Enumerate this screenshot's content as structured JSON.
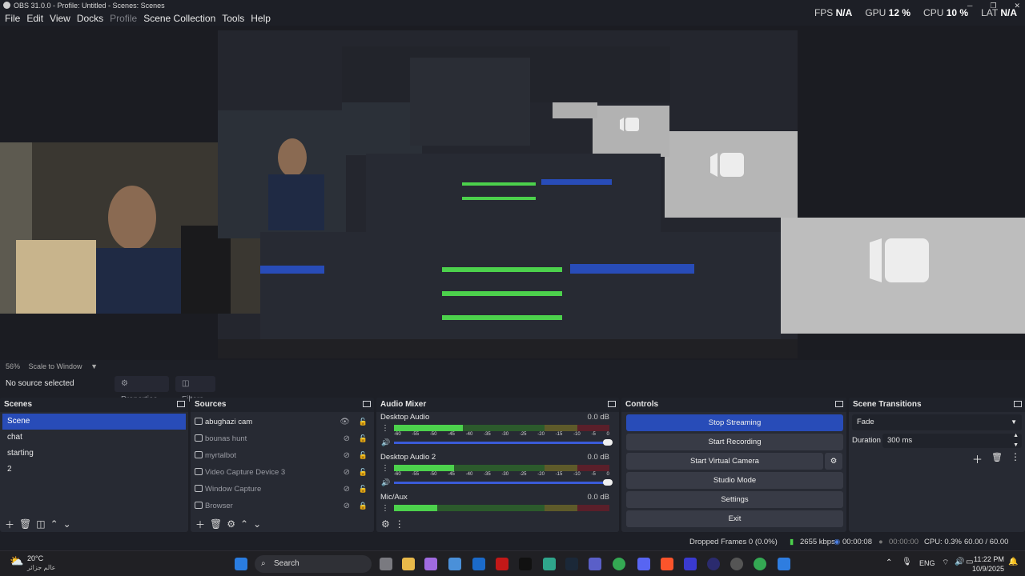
{
  "window": {
    "title": "OBS 31.0.0 - Profile: Untitled - Scenes: Scenes",
    "controls": [
      "─",
      "❐",
      "✕"
    ]
  },
  "menu": [
    {
      "label": "File",
      "disabled": false
    },
    {
      "label": "Edit",
      "disabled": false
    },
    {
      "label": "View",
      "disabled": false
    },
    {
      "label": "Docks",
      "disabled": false
    },
    {
      "label": "Profile",
      "disabled": true
    },
    {
      "label": "Scene Collection",
      "disabled": false
    },
    {
      "label": "Tools",
      "disabled": false
    },
    {
      "label": "Help",
      "disabled": false
    }
  ],
  "stats": {
    "fps_label": "FPS",
    "fps_value": "N/A",
    "gpu_label": "GPU",
    "gpu_value": "12 %",
    "cpu_label": "CPU",
    "cpu_value": "10 %",
    "lat_label": "LAT",
    "lat_value": "N/A"
  },
  "preview": {
    "zoom": "56%",
    "scale_mode": "Scale to Window"
  },
  "context": {
    "selection": "No source selected",
    "properties_label": "Properties",
    "filters_label": "Filters"
  },
  "scenes": {
    "title": "Scenes",
    "items": [
      {
        "label": "Scene",
        "selected": true
      },
      {
        "label": "chat",
        "selected": false
      },
      {
        "label": "starting",
        "selected": false
      },
      {
        "label": "2",
        "selected": false
      }
    ]
  },
  "sources": {
    "title": "Sources",
    "items": [
      {
        "label": "abughazi cam",
        "visible": true,
        "locked": false
      },
      {
        "label": "bounas hunt",
        "visible": false,
        "locked": false
      },
      {
        "label": "myrtalbot",
        "visible": false,
        "locked": false
      },
      {
        "label": "Video Capture Device 3",
        "visible": false,
        "locked": false
      },
      {
        "label": "Window Capture",
        "visible": false,
        "locked": false
      },
      {
        "label": "Browser",
        "visible": false,
        "locked": true
      }
    ]
  },
  "audio_mixer": {
    "title": "Audio Mixer",
    "scale": [
      "-60",
      "-55",
      "-50",
      "-45",
      "-40",
      "-35",
      "-30",
      "-25",
      "-20",
      "-15",
      "-10",
      "-5",
      "0"
    ],
    "channels": [
      {
        "name": "Desktop Audio",
        "db": "0.0 dB",
        "level": 0.32
      },
      {
        "name": "Desktop Audio 2",
        "db": "0.0 dB",
        "level": 0.28
      },
      {
        "name": "Mic/Aux",
        "db": "0.0 dB",
        "level": 0.2
      }
    ]
  },
  "controls": {
    "title": "Controls",
    "stop_streaming": "Stop Streaming",
    "start_recording": "Start Recording",
    "start_virtual_camera": "Start Virtual Camera",
    "studio_mode": "Studio Mode",
    "settings": "Settings",
    "exit": "Exit"
  },
  "transitions": {
    "title": "Scene Transitions",
    "selected": "Fade",
    "duration_label": "Duration",
    "duration_value": "300 ms"
  },
  "status": {
    "dropped_frames": "Dropped Frames 0 (0.0%)",
    "bitrate": "2655 kbps",
    "stream_time": "00:00:08",
    "record_time": "00:00:00",
    "cpu": "CPU: 0.3%",
    "fps": "60.00 / 60.00 FPS"
  },
  "taskbar": {
    "weather_temp": "20°C",
    "weather_note": "عالم جزائر",
    "search_label": "Search",
    "language": "ENG",
    "time": "11:22 PM",
    "date": "10/9/2025"
  },
  "colors": {
    "accent": "#284cb8",
    "meter_green": "#4cd14c",
    "meter_yellow": "#c8b23a",
    "meter_red": "#a02238"
  }
}
